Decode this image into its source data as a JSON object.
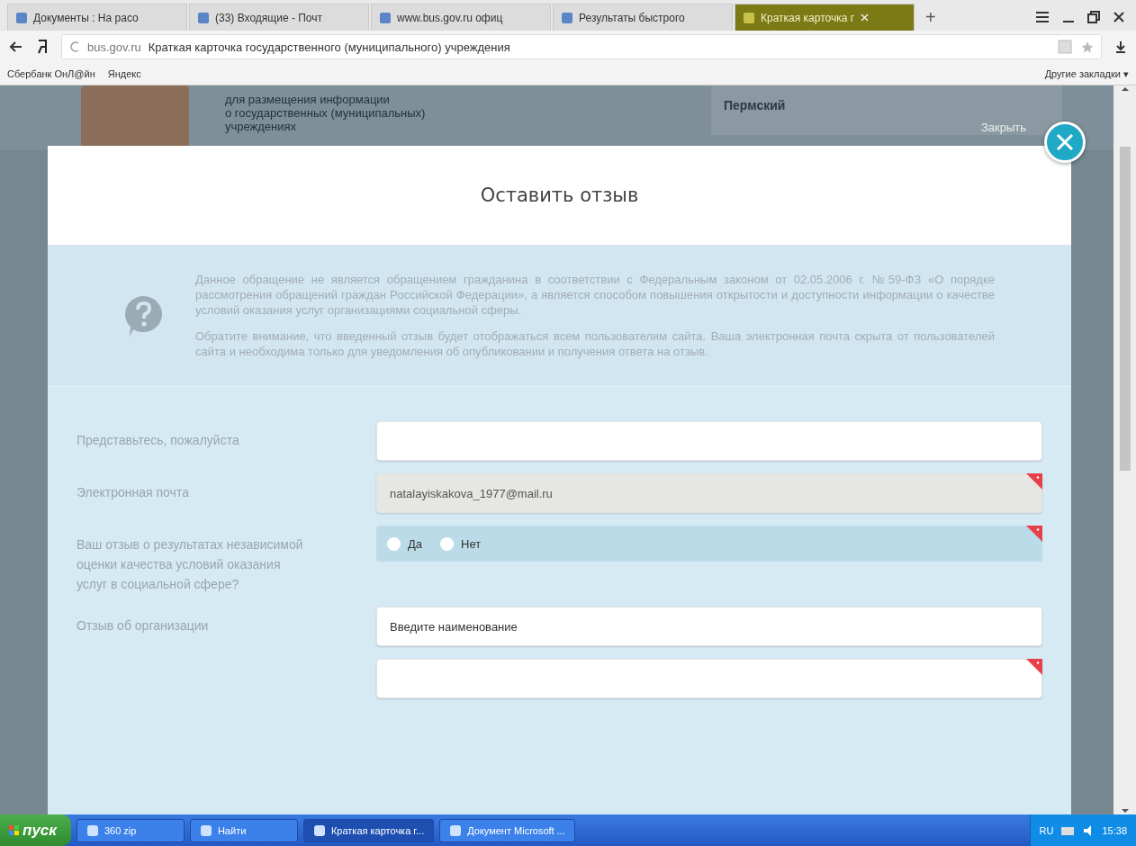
{
  "browser": {
    "tabs": [
      {
        "label": "Документы : На расо",
        "selected": false
      },
      {
        "label": "(33) Входящие - Почт",
        "selected": false
      },
      {
        "label": "www.bus.gov.ru офиц",
        "selected": false
      },
      {
        "label": "Результаты быстрого",
        "selected": false
      },
      {
        "label": "Краткая карточка г",
        "selected": true
      }
    ],
    "new_tab": "+",
    "address": {
      "domain": "bus.gov.ru",
      "title": "Краткая карточка государственного (муниципального) учреждения"
    },
    "bookmarks": [
      "Сбербанк ОнЛ@йн",
      "Яндекс"
    ],
    "other_bookmarks": "Другие закладки ▾"
  },
  "background_page": {
    "heading_lines": [
      "для размещения информации",
      "о государственных (муниципальных)",
      "учреждениях"
    ],
    "region": "Пермский",
    "close_label": "Закрыть"
  },
  "modal": {
    "title": "Оставить отзыв",
    "notice": [
      "Данное обращение не является обращением гражданина в соответствии с Федеральным законом от 02.05.2006 г. №59-ФЗ «О порядке рассмотрения обращений граждан Российской Федерации», а является способом повышения открытости и доступности информации о качестве условий оказания услуг организациями социальной сферы.",
      "Обратите внимание, что введенный отзыв будет отображаться всем пользователям сайта. Ваша электронная почта скрыта от пользователей сайта и необходима только для уведомления об опубликовании и получения ответа на отзыв."
    ],
    "fields": [
      {
        "kind": "text",
        "label": "Представьтесь, пожалуйста",
        "required": false,
        "disabled": false
      },
      {
        "kind": "text",
        "label": "Электронная почта",
        "value": "natalayiskakova_1977@mail.ru",
        "required": true,
        "disabled": true
      },
      {
        "kind": "radio",
        "label": "Ваш отзыв о результатах независимой оценки качества условий оказания услуг в социальной сфере?",
        "required": true,
        "options": [
          {
            "label": "Да",
            "selected": false
          },
          {
            "label": "Нет",
            "selected": false
          }
        ]
      },
      {
        "kind": "text",
        "label": "Отзыв об организации",
        "placeholder": "Введите наименование",
        "required": false,
        "disabled": false
      },
      {
        "kind": "text",
        "required": true,
        "disabled": false
      }
    ]
  },
  "taskbar": {
    "start": "пуск",
    "items": [
      {
        "label": "360 zip",
        "selected": false
      },
      {
        "label": "Найти",
        "selected": false
      },
      {
        "label": "Краткая карточка г...",
        "selected": true
      },
      {
        "label": "Документ Microsoft ...",
        "selected": false
      }
    ],
    "language": "RU",
    "clock": "15:38"
  }
}
